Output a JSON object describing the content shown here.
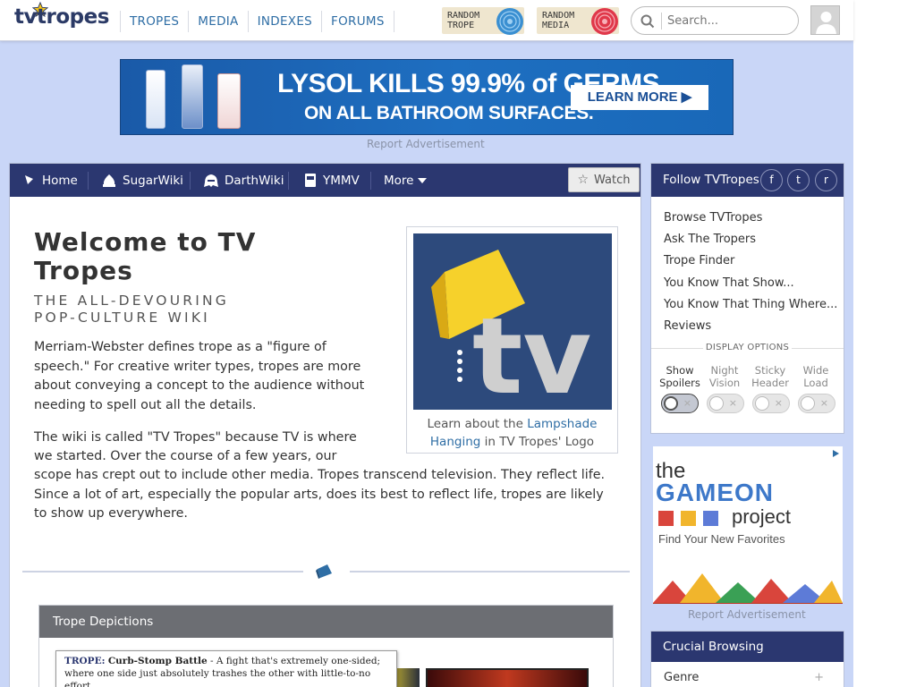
{
  "header": {
    "logo_text": "tvtropes",
    "nav": [
      "TROPES",
      "MEDIA",
      "INDEXES",
      "FORUMS"
    ],
    "random_trope": "RANDOM\nTROPE",
    "random_media": "RANDOM\nMEDIA",
    "search_placeholder": "Search..."
  },
  "ad": {
    "line1": "LYSOL KILLS 99.9% of GERMS",
    "line2": "ON ALL BATHROOM SURFACES.",
    "cta": "LEARN MORE ▶",
    "report": "Report Advertisement"
  },
  "main_nav": {
    "items": [
      "Home",
      "SugarWiki",
      "DarthWiki",
      "YMMV",
      "More"
    ],
    "watch": "Watch"
  },
  "content": {
    "title": "Welcome to TV Tropes",
    "tagline": "THE ALL-DEVOURING\nPOP-CULTURE WIKI",
    "para1": "Merriam-Webster defines trope as a \"figure of speech.\" For creative writer types, tropes are more about conveying a concept to the audience without needing to spell out all the details.",
    "para2a": "The wiki is called \"TV Tropes\" because TV is where",
    "para2b": "we started. Over the course of a few years, our",
    "para2c": "scope has crept out to include other media. Tropes transcend television. They reflect life. Since a lot of art, especially the popular arts, does its best to reflect life, tropes are likely to show up everywhere.",
    "logo_caption_pre": "Learn about the ",
    "logo_caption_link": "Lampshade Hanging",
    "logo_caption_post": " in TV Tropes' Logo",
    "logo_letters": "tv"
  },
  "depictions": {
    "header": "Trope Depictions",
    "tip_label": "TROPE:",
    "tip_title": "Curb-Stomp Battle",
    "tip_text": " - A fight that's extremely one-sided; where one side just absolutely trashes the other with little-to-no effort."
  },
  "sidebar": {
    "follow_title": "Follow TVTropes",
    "social": [
      "f",
      "t",
      "r"
    ],
    "links": [
      "Browse TVTropes",
      "Ask The Tropers",
      "Trope Finder",
      "You Know That Show...",
      "You Know That Thing Where...",
      "Reviews"
    ],
    "display_options": "DISPLAY OPTIONS",
    "toggles": [
      {
        "label": "Show Spoilers",
        "on": true
      },
      {
        "label": "Night Vision",
        "on": false
      },
      {
        "label": "Sticky Header",
        "on": false
      },
      {
        "label": "Wide Load",
        "on": false
      }
    ],
    "toggle_off_glyph": "×",
    "ad_the": "the",
    "ad_gameon": "GAMEON",
    "ad_project": "project",
    "ad_tagline": "Find Your New Favorites",
    "ad_report": "Report Advertisement",
    "crucial_title": "Crucial Browsing",
    "crucial_item": "Genre",
    "crucial_plus": "+"
  },
  "colors": {
    "navy": "#2b3770",
    "link": "#2f6ea5",
    "background": "#c9d6f7"
  }
}
